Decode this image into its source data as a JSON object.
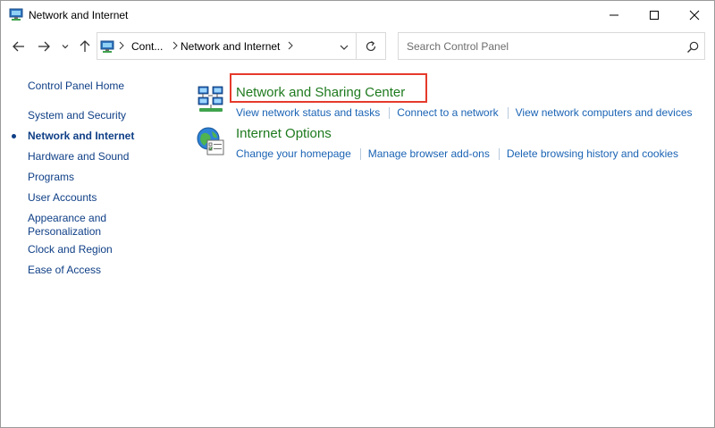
{
  "window": {
    "title": "Network and Internet"
  },
  "address_bar": {
    "crumbs": [
      "Cont...",
      "Network and Internet"
    ]
  },
  "search": {
    "placeholder": "Search Control Panel"
  },
  "sidebar": {
    "home_label": "Control Panel Home",
    "items": [
      {
        "label": "System and Security",
        "current": false
      },
      {
        "label": "Network and Internet",
        "current": true
      },
      {
        "label": "Hardware and Sound",
        "current": false
      },
      {
        "label": "Programs",
        "current": false
      },
      {
        "label": "User Accounts",
        "current": false
      },
      {
        "label": "Appearance and Personalization",
        "current": false
      },
      {
        "label": "Clock and Region",
        "current": false
      },
      {
        "label": "Ease of Access",
        "current": false
      }
    ]
  },
  "categories": [
    {
      "title": "Network and Sharing Center",
      "icon": "network-sharing-icon",
      "highlighted": true,
      "links": [
        "View network status and tasks",
        "Connect to a network",
        "View network computers and devices"
      ]
    },
    {
      "title": "Internet Options",
      "icon": "internet-options-icon",
      "highlighted": false,
      "links": [
        "Change your homepage",
        "Manage browser add-ons",
        "Delete browsing history and cookies"
      ]
    }
  ],
  "colors": {
    "link": "#1a63b4",
    "category_title": "#1e7a1e",
    "sidebar_link": "#0f3f86",
    "highlight": "#e53a2b"
  }
}
